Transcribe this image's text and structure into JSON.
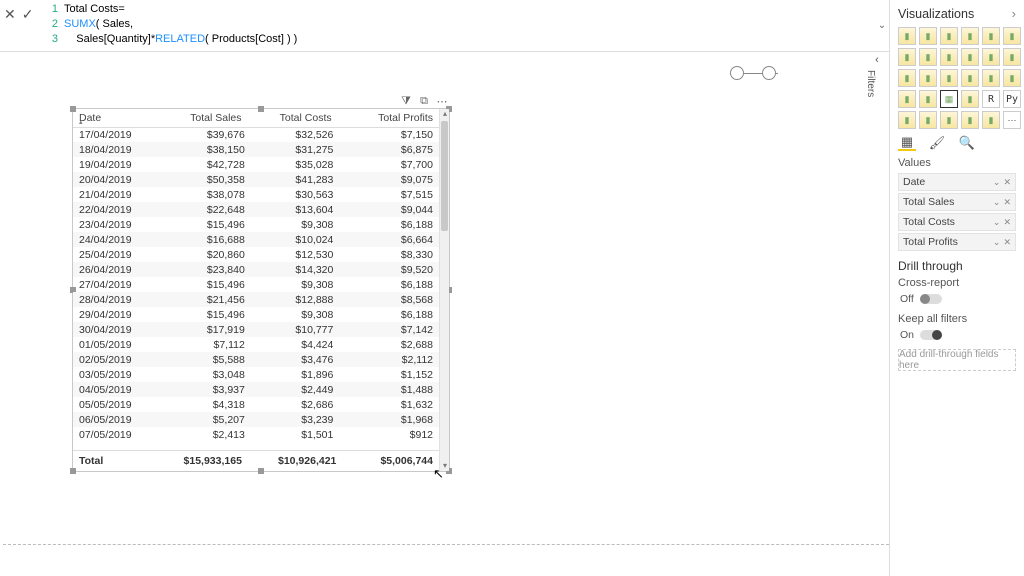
{
  "formula": {
    "line1_num": "1",
    "line1_a": "Total Costs ",
    "line1_eq": "=",
    "line2_num": "2",
    "line2_fn": "SUMX",
    "line2_rest": "( Sales,",
    "line3_num": "3",
    "line3_indent": "    ",
    "line3_a": "Sales[Quantity] ",
    "line3_op": "*",
    "line3_b": " ",
    "line3_fn": "RELATED",
    "line3_rest": "( Products[Cost] ) )"
  },
  "filters_label": "Filters",
  "viz": {
    "title": "Visualizations",
    "values_label": "Values",
    "wells": [
      "Date",
      "Total Sales",
      "Total Costs",
      "Total Profits"
    ],
    "drill_title": "Drill through",
    "cross_report": "Cross-report",
    "cross_state": "Off",
    "keep_filters": "Keep all filters",
    "keep_state": "On",
    "drop_hint": "Add drill-through fields here"
  },
  "table": {
    "headers": [
      "Date",
      "Total Sales",
      "Total Costs",
      "Total Profits"
    ],
    "rows": [
      [
        "17/04/2019",
        "$39,676",
        "$32,526",
        "$7,150"
      ],
      [
        "18/04/2019",
        "$38,150",
        "$31,275",
        "$6,875"
      ],
      [
        "19/04/2019",
        "$42,728",
        "$35,028",
        "$7,700"
      ],
      [
        "20/04/2019",
        "$50,358",
        "$41,283",
        "$9,075"
      ],
      [
        "21/04/2019",
        "$38,078",
        "$30,563",
        "$7,515"
      ],
      [
        "22/04/2019",
        "$22,648",
        "$13,604",
        "$9,044"
      ],
      [
        "23/04/2019",
        "$15,496",
        "$9,308",
        "$6,188"
      ],
      [
        "24/04/2019",
        "$16,688",
        "$10,024",
        "$6,664"
      ],
      [
        "25/04/2019",
        "$20,860",
        "$12,530",
        "$8,330"
      ],
      [
        "26/04/2019",
        "$23,840",
        "$14,320",
        "$9,520"
      ],
      [
        "27/04/2019",
        "$15,496",
        "$9,308",
        "$6,188"
      ],
      [
        "28/04/2019",
        "$21,456",
        "$12,888",
        "$8,568"
      ],
      [
        "29/04/2019",
        "$15,496",
        "$9,308",
        "$6,188"
      ],
      [
        "30/04/2019",
        "$17,919",
        "$10,777",
        "$7,142"
      ],
      [
        "01/05/2019",
        "$7,112",
        "$4,424",
        "$2,688"
      ],
      [
        "02/05/2019",
        "$5,588",
        "$3,476",
        "$2,112"
      ],
      [
        "03/05/2019",
        "$3,048",
        "$1,896",
        "$1,152"
      ],
      [
        "04/05/2019",
        "$3,937",
        "$2,449",
        "$1,488"
      ],
      [
        "05/05/2019",
        "$4,318",
        "$2,686",
        "$1,632"
      ],
      [
        "06/05/2019",
        "$5,207",
        "$3,239",
        "$1,968"
      ],
      [
        "07/05/2019",
        "$2,413",
        "$1,501",
        "$912"
      ]
    ],
    "total_label": "Total",
    "totals": [
      "$15,933,165",
      "$10,926,421",
      "$5,006,744"
    ]
  }
}
